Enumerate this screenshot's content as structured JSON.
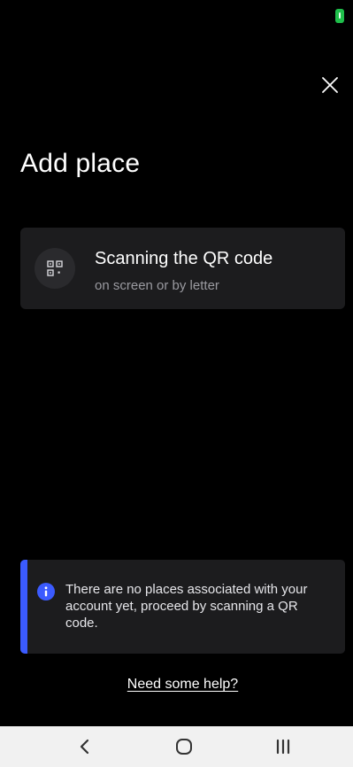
{
  "colors": {
    "background": "#000000",
    "card": "#1c1c1e",
    "accent": "#3b5bff",
    "battery": "#1fbf4b",
    "subtitle": "#9a9aa0"
  },
  "status_bar": {
    "icons": [
      "battery-icon"
    ]
  },
  "header": {
    "close_icon": "close-icon",
    "title": "Add place"
  },
  "scan_option": {
    "icon": "qr-code-icon",
    "title": "Scanning the QR code",
    "subtitle": "on screen or by letter"
  },
  "info_banner": {
    "icon": "info-icon",
    "text": "There are no places associated with your account yet, proceed by scanning a QR code."
  },
  "help": {
    "link_label": "Need some help?"
  },
  "nav_bar": {
    "buttons": [
      "back-icon",
      "home-icon",
      "recents-icon"
    ]
  }
}
